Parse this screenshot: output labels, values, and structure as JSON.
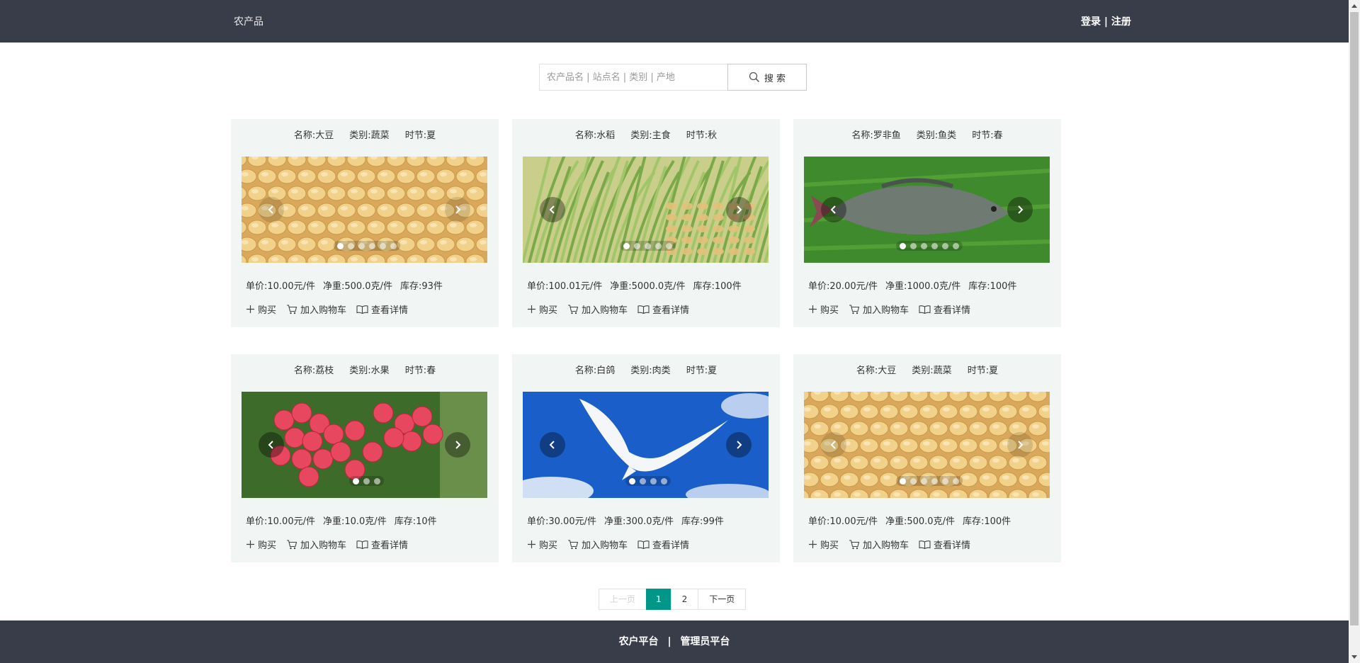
{
  "header": {
    "brand": "农产品",
    "login": "登录",
    "separator": " | ",
    "register": "注册"
  },
  "search": {
    "placeholder": "农产品名 | 站点名 | 类别 | 产地",
    "button_label": "搜 索"
  },
  "products": [
    {
      "name": "名称:大豆",
      "category": "类别:蔬菜",
      "season": "时节:夏",
      "price": "单价:10.00元/件",
      "weight": "净重:500.0克/件",
      "stock": "库存:93件",
      "image": "soybean",
      "dot_count": 6,
      "active_dot": 0
    },
    {
      "name": "名称:水稻",
      "category": "类别:主食",
      "season": "时节:秋",
      "price": "单价:100.01元/件",
      "weight": "净重:5000.0克/件",
      "stock": "库存:100件",
      "image": "rice",
      "dot_count": 5,
      "active_dot": 0
    },
    {
      "name": "名称:罗非鱼",
      "category": "类别:鱼类",
      "season": "时节:春",
      "price": "单价:20.00元/件",
      "weight": "净重:1000.0克/件",
      "stock": "库存:100件",
      "image": "fish",
      "dot_count": 6,
      "active_dot": 0
    },
    {
      "name": "名称:荔枝",
      "category": "类别:水果",
      "season": "时节:春",
      "price": "单价:10.00元/件",
      "weight": "净重:10.0克/件",
      "stock": "库存:10件",
      "image": "lychee",
      "dot_count": 3,
      "active_dot": 0
    },
    {
      "name": "名称:白鸽",
      "category": "类别:肉类",
      "season": "时节:夏",
      "price": "单价:30.00元/件",
      "weight": "净重:300.0克/件",
      "stock": "库存:99件",
      "image": "dove",
      "dot_count": 4,
      "active_dot": 0
    },
    {
      "name": "名称:大豆",
      "category": "类别:蔬菜",
      "season": "时节:夏",
      "price": "单价:10.00元/件",
      "weight": "净重:500.0克/件",
      "stock": "库存:100件",
      "image": "soybean",
      "dot_count": 6,
      "active_dot": 0
    }
  ],
  "actions": {
    "buy": "购买",
    "add_to_cart": "加入购物车",
    "view_details": "查看详情"
  },
  "pagination": {
    "prev": "上一页",
    "pages": [
      "1",
      "2"
    ],
    "current": "1",
    "next": "下一页"
  },
  "footer": {
    "farmer_platform": "农户平台",
    "separator": "|",
    "admin_platform": "管理员平台"
  },
  "colors": {
    "header_bg": "#393d49",
    "card_bg": "#f1f5f3",
    "accent": "#009688"
  },
  "icons": {
    "search": "search-icon",
    "buy": "plus-icon",
    "cart": "cart-icon",
    "details": "book-icon",
    "prev": "chevron-left-icon",
    "next": "chevron-right-icon"
  }
}
